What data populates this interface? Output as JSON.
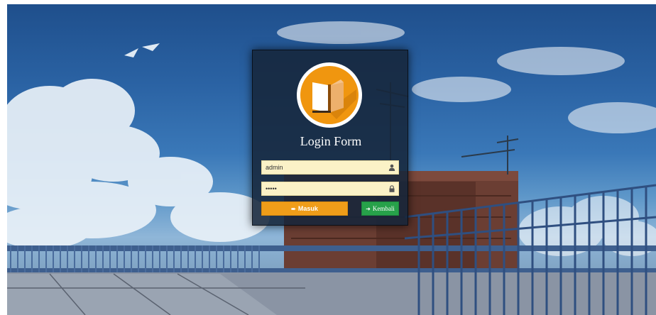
{
  "login": {
    "title": "Login Form",
    "username_value": "admin",
    "password_value": "admin",
    "login_button": "Masuk",
    "back_button": "Kembali"
  },
  "icons": {
    "logo": "book-icon",
    "username": "user-icon",
    "password": "lock-icon",
    "login": "sign-in-icon",
    "back": "sign-out-icon"
  },
  "colors": {
    "login_button": "#ef9d19",
    "back_button": "#27a14a",
    "input_background": "#fbf2c7",
    "logo_orange": "#f0960f"
  }
}
